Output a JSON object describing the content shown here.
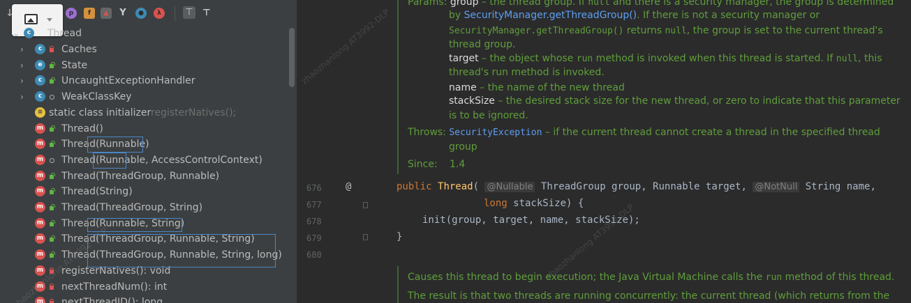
{
  "structure": {
    "root_label": "Thread",
    "items": [
      {
        "label": "Caches",
        "suffix": "",
        "kind": "c",
        "vis": "priv",
        "expandable": true
      },
      {
        "label": "State",
        "suffix": "",
        "kind": "e",
        "vis": "pub",
        "expandable": true
      },
      {
        "label": "UncaughtExceptionHandler",
        "suffix": "",
        "kind": "c",
        "vis": "pub",
        "expandable": true
      },
      {
        "label": "WeakClassKey",
        "suffix": "",
        "kind": "c",
        "vis": "pkg",
        "expandable": true
      },
      {
        "label": "static class initializer",
        "suffix": " registerNatives();",
        "kind": "s",
        "vis": "",
        "expandable": false
      },
      {
        "label": "Thread()",
        "suffix": "",
        "kind": "m",
        "vis": "pub",
        "expandable": false
      },
      {
        "label": "Thread(Runnable)",
        "suffix": "",
        "kind": "m",
        "vis": "pub",
        "expandable": false
      },
      {
        "label": "Thread(Runnable, AccessControlContext)",
        "suffix": "",
        "kind": "m",
        "vis": "pkg",
        "expandable": false
      },
      {
        "label": "Thread(ThreadGroup, Runnable)",
        "suffix": "",
        "kind": "m",
        "vis": "pub",
        "expandable": false
      },
      {
        "label": "Thread(String)",
        "suffix": "",
        "kind": "m",
        "vis": "pub",
        "expandable": false
      },
      {
        "label": "Thread(ThreadGroup, String)",
        "suffix": "",
        "kind": "m",
        "vis": "pub",
        "expandable": false
      },
      {
        "label": "Thread(Runnable, String)",
        "suffix": "",
        "kind": "m",
        "vis": "pub",
        "expandable": false
      },
      {
        "label": "Thread(ThreadGroup, Runnable, String)",
        "suffix": "",
        "kind": "m",
        "vis": "pub",
        "expandable": false
      },
      {
        "label": "Thread(ThreadGroup, Runnable, String, long)",
        "suffix": "",
        "kind": "m",
        "vis": "pub",
        "expandable": false
      },
      {
        "label": "registerNatives(): void",
        "suffix": "",
        "kind": "m",
        "vis": "priv",
        "expandable": false
      },
      {
        "label": "nextThreadNum(): int",
        "suffix": "",
        "kind": "m",
        "vis": "priv",
        "expandable": false
      },
      {
        "label": "nextThreadID(): long",
        "suffix": "",
        "kind": "m",
        "vis": "priv",
        "expandable": false
      }
    ],
    "toolbar_icons": [
      "sort-icon",
      "property-icon",
      "field-icon",
      "static-icon",
      "lock-icon",
      "hierarchy-icon",
      "circle-icon",
      "lambda-icon",
      "expand-all-icon",
      "collapse-all-icon"
    ]
  },
  "watermark": {
    "text": "zhaozhanlong  AT3992-DLP"
  },
  "editor": {
    "doc_top": {
      "l1": {
        "label": "Params: ",
        "name": "group",
        "t1": " – the thread group. If ",
        "null": "null",
        "t2": " and there is a security manager, the group is determined"
      },
      "l2": {
        "t1": "by ",
        "link": "SecurityManager.getThreadGroup()",
        "t2": ". If there is not a security manager or"
      },
      "l3": {
        "mono": "SecurityManager.getThreadGroup()",
        "t1": " returns ",
        "null": "null",
        "t2": ", the group is set to the current thread's"
      },
      "l4": "thread group.",
      "l5": {
        "name": "target",
        "t1": " – the object whose ",
        "run": "run",
        "t2": " method is invoked when this thread is started. If ",
        "null": "null",
        "t3": ", this"
      },
      "l6": "thread's run method is invoked.",
      "l7": {
        "name": "name",
        "t1": " – the name of the new thread"
      },
      "l8": {
        "name": "stackSize",
        "t1": " – the desired stack size for the new thread, or zero to indicate that this parameter"
      },
      "l9": "is to be ignored.",
      "throws_label": "Throws: ",
      "throws_link": "SecurityException",
      "throws_text": " – if the current thread cannot create a thread in the specified thread",
      "throws_text2": "group",
      "since_label": "Since:",
      "since_value": "1.4"
    },
    "lines": [
      "676",
      "677",
      "678",
      "679",
      "680"
    ],
    "code": {
      "l676_kw": "public",
      "l676_fn": "Thread",
      "l676_p1": "(",
      "l676_ann1": "@Nullable",
      "l676_p2": " ThreadGroup group, Runnable target,",
      "l676_ann2": "@NotNull",
      "l676_p3": " String name,",
      "l677_kw": "long",
      "l677_p": " stackSize) {",
      "l678": "init(group, target, name, stackSize);",
      "l679": "}",
      "at_marker": "@"
    },
    "doc_bottom": {
      "b1_t1": "Causes this thread to begin execution; the Java Virtual Machine calls the ",
      "b1_run": "run",
      "b1_t2": " method of this thread.",
      "b2": "The result is that two threads are running concurrently: the current thread (which returns from the"
    }
  }
}
